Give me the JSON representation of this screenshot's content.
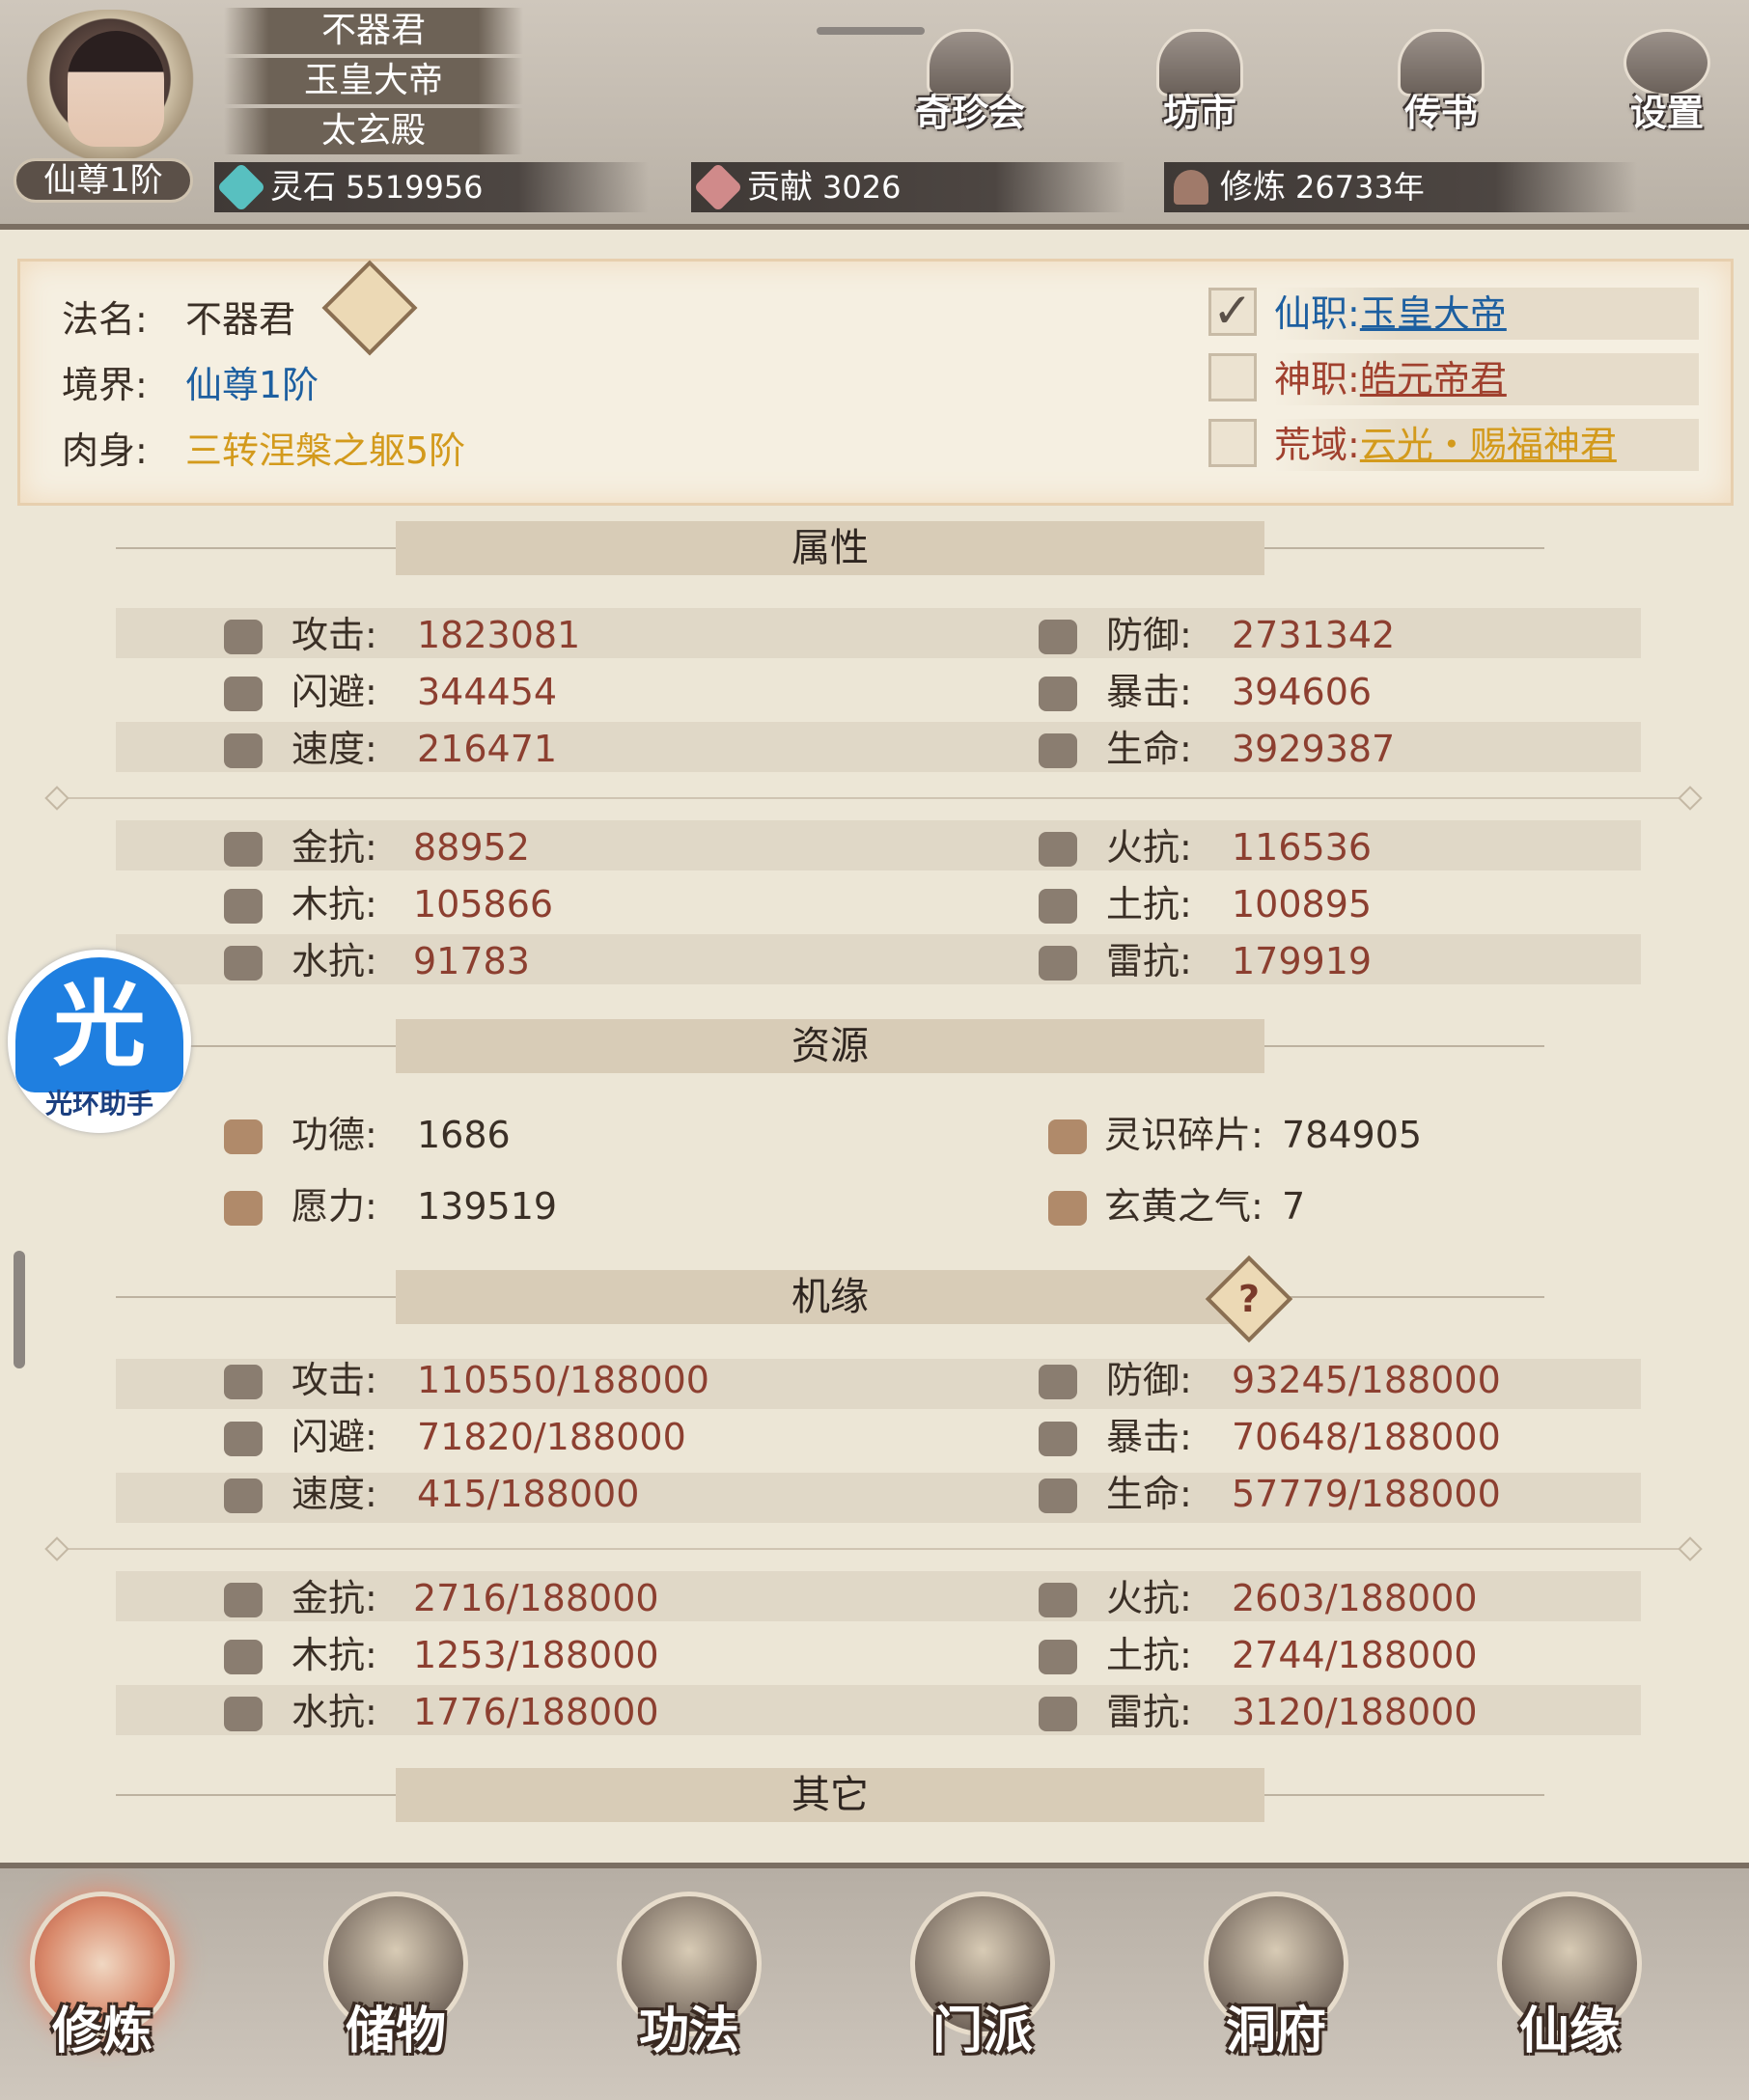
{
  "header": {
    "names": [
      "不器君",
      "玉皇大帝",
      "太玄殿"
    ],
    "rank_tag": "仙尊1阶",
    "buttons": [
      "奇珍会",
      "坊市",
      "传书",
      "设置"
    ],
    "resources": [
      {
        "label": "灵石",
        "value": "5519956",
        "color": "#58c0c0"
      },
      {
        "label": "贡献",
        "value": "3026",
        "color": "#d08a8a"
      },
      {
        "label": "修炼",
        "value": "26733年",
        "color": "#a07a6a"
      }
    ]
  },
  "profile": {
    "dharma_label": "法名:",
    "dharma_name": "不器君",
    "realm_label": "境界:",
    "realm": "仙尊1阶",
    "body_label": "肉身:",
    "body": "三转涅槃之躯5阶",
    "realm_color": "#1d5fa0",
    "body_color": "#d39a1c",
    "roles": [
      {
        "label": "仙职:",
        "value": "玉皇大帝",
        "checked": true,
        "color": "#1d5fa0"
      },
      {
        "label": "神职:",
        "value": "皓元帝君",
        "checked": false,
        "color": "#a0402e"
      },
      {
        "label": "荒域:",
        "value": "云光・赐福神君",
        "checked": false,
        "color": "#d39a1c"
      }
    ]
  },
  "sections": {
    "attributes": "属性",
    "resources": "资源",
    "fortune": "机缘",
    "other": "其它"
  },
  "attributes": {
    "combat": [
      {
        "k": "攻击:",
        "v": "1823081",
        "icon": "attack-icon"
      },
      {
        "k": "防御:",
        "v": "2731342",
        "icon": "defense-icon"
      },
      {
        "k": "闪避:",
        "v": "344454",
        "icon": "dodge-icon"
      },
      {
        "k": "暴击:",
        "v": "394606",
        "icon": "crit-icon"
      },
      {
        "k": "速度:",
        "v": "216471",
        "icon": "speed-icon"
      },
      {
        "k": "生命:",
        "v": "3929387",
        "icon": "life-icon"
      }
    ],
    "resist": [
      {
        "k": "金抗:",
        "v": "88952",
        "icon": "metal-icon"
      },
      {
        "k": "火抗:",
        "v": "116536",
        "icon": "fire-icon"
      },
      {
        "k": "木抗:",
        "v": "105866",
        "icon": "wood-icon"
      },
      {
        "k": "土抗:",
        "v": "100895",
        "icon": "earth-icon"
      },
      {
        "k": "水抗:",
        "v": "91783",
        "icon": "water-icon"
      },
      {
        "k": "雷抗:",
        "v": "179919",
        "icon": "thunder-icon"
      }
    ]
  },
  "resources": [
    {
      "k": "功德:",
      "v": "1686",
      "icon": "merit-icon"
    },
    {
      "k": "灵识碎片:",
      "v": "784905",
      "icon": "shard-icon"
    },
    {
      "k": "愿力:",
      "v": "139519",
      "icon": "wish-icon"
    },
    {
      "k": "玄黄之气:",
      "v": "7",
      "icon": "qi-icon"
    }
  ],
  "fortune": {
    "combat": [
      {
        "k": "攻击:",
        "v": "110550/188000",
        "icon": "attack-icon"
      },
      {
        "k": "防御:",
        "v": "93245/188000",
        "icon": "defense-icon"
      },
      {
        "k": "闪避:",
        "v": "71820/188000",
        "icon": "dodge-icon"
      },
      {
        "k": "暴击:",
        "v": "70648/188000",
        "icon": "crit-icon"
      },
      {
        "k": "速度:",
        "v": "415/188000",
        "icon": "speed-icon"
      },
      {
        "k": "生命:",
        "v": "57779/188000",
        "icon": "life-icon"
      }
    ],
    "resist": [
      {
        "k": "金抗:",
        "v": "2716/188000",
        "icon": "metal-icon"
      },
      {
        "k": "火抗:",
        "v": "2603/188000",
        "icon": "fire-icon"
      },
      {
        "k": "木抗:",
        "v": "1253/188000",
        "icon": "wood-icon"
      },
      {
        "k": "土抗:",
        "v": "2744/188000",
        "icon": "earth-icon"
      },
      {
        "k": "水抗:",
        "v": "1776/188000",
        "icon": "water-icon"
      },
      {
        "k": "雷抗:",
        "v": "3120/188000",
        "icon": "thunder-icon"
      }
    ],
    "help": "?"
  },
  "float_widget": {
    "glyph": "光",
    "caption": "光环助手"
  },
  "nav": [
    "修炼",
    "储物",
    "功法",
    "门派",
    "洞府",
    "仙缘"
  ]
}
